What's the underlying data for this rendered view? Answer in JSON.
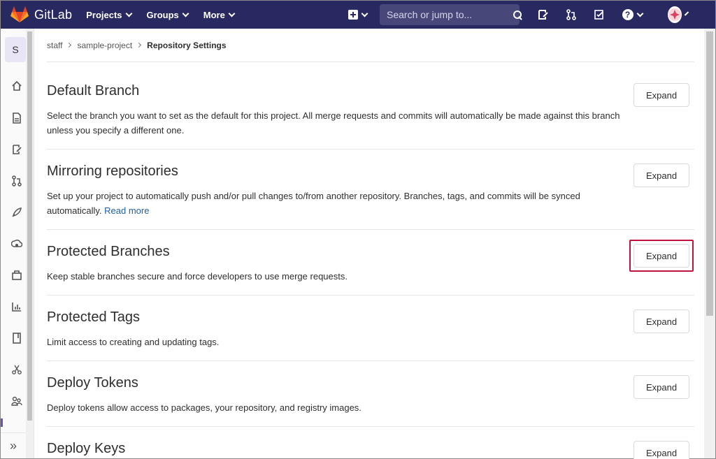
{
  "navbar": {
    "brand": "GitLab",
    "menus": [
      {
        "label": "Projects"
      },
      {
        "label": "Groups"
      },
      {
        "label": "More"
      }
    ],
    "search_placeholder": "Search or jump to...",
    "help_glyph": "?"
  },
  "sidebar": {
    "project_initial": "S",
    "icons": [
      "home-icon",
      "repository-icon",
      "issues-icon",
      "merge-requests-icon",
      "ci-cd-icon",
      "operations-icon",
      "packages-icon",
      "analytics-icon",
      "wiki-icon",
      "snippets-icon",
      "members-icon"
    ],
    "collapse_glyph": "»"
  },
  "breadcrumb": {
    "items": [
      "staff",
      "sample-project"
    ],
    "current": "Repository Settings"
  },
  "sections": [
    {
      "title": "Default Branch",
      "description": "Select the branch you want to set as the default for this project. All merge requests and commits will automatically be made against this branch unless you specify a different one.",
      "button": "Expand"
    },
    {
      "title": "Mirroring repositories",
      "description": "Set up your project to automatically push and/or pull changes to/from another repository. Branches, tags, and commits will be synced automatically.",
      "link": "Read more",
      "button": "Expand"
    },
    {
      "title": "Protected Branches",
      "description": "Keep stable branches secure and force developers to use merge requests.",
      "button": "Expand"
    },
    {
      "title": "Protected Tags",
      "description": "Limit access to creating and updating tags.",
      "button": "Expand"
    },
    {
      "title": "Deploy Tokens",
      "description": "Deploy tokens allow access to packages, your repository, and registry images.",
      "button": "Expand"
    },
    {
      "title": "Deploy Keys",
      "description": "",
      "button": "Expand"
    }
  ],
  "colors": {
    "navbar": "#292961",
    "highlight": "#c0123e",
    "link": "#1f5fa8"
  }
}
